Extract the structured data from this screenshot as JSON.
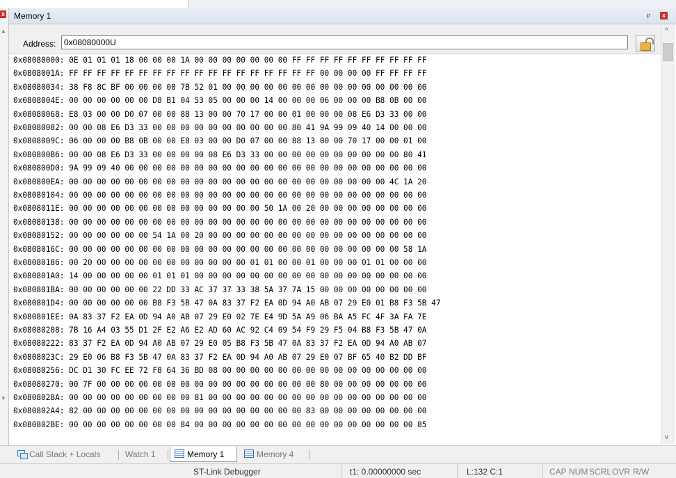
{
  "window": {
    "title": "Memory 1",
    "pin_glyph": "ᵽ",
    "close_glyph": "x"
  },
  "address_bar": {
    "label": "Address:",
    "value": "0x08080000U"
  },
  "memory_rows": [
    {
      "addr": "0x08080000:",
      "bytes": "0E 01 01 01 18 00 00 00 1A 00 00 00 00 00 00 00 FF FF FF FF FF FF FF FF FF FF"
    },
    {
      "addr": "0x0808001A:",
      "bytes": "FF FF FF FF FF FF FF FF FF FF FF FF FF FF FF FF FF FF 00 00 00 00 FF FF FF FF"
    },
    {
      "addr": "0x08080034:",
      "bytes": "38 F8 8C BF 00 00 00 00 7B 52 01 00 00 00 00 00 00 00 00 00 00 00 00 00 00 00"
    },
    {
      "addr": "0x0808004E:",
      "bytes": "00 00 00 00 00 00 D8 B1 04 53 05 00 00 00 14 00 00 00 06 00 00 00 B8 0B 00 00"
    },
    {
      "addr": "0x08080068:",
      "bytes": "E8 03 00 00 D0 07 00 00 88 13 00 00 70 17 00 00 01 00 00 00 08 E6 D3 33 00 00"
    },
    {
      "addr": "0x08080082:",
      "bytes": "00 00 08 E6 D3 33 00 00 00 00 00 00 00 00 00 00 80 41 9A 99 09 40 14 00 00 00"
    },
    {
      "addr": "0x0808009C:",
      "bytes": "06 00 00 00 B8 0B 00 00 E8 03 00 00 D0 07 00 00 88 13 00 00 70 17 00 00 01 00"
    },
    {
      "addr": "0x080800B6:",
      "bytes": "00 00 08 E6 D3 33 00 00 00 00 08 E6 D3 33 00 00 00 00 00 00 00 00 00 00 80 41"
    },
    {
      "addr": "0x080800D0:",
      "bytes": "9A 99 09 40 00 00 00 00 00 00 00 00 00 00 00 00 00 00 00 00 00 00 00 00 00 00"
    },
    {
      "addr": "0x080800EA:",
      "bytes": "00 00 00 00 00 00 00 00 00 00 00 00 00 00 00 00 00 00 00 00 00 00 00 4C 1A 20"
    },
    {
      "addr": "0x08080104:",
      "bytes": "00 00 00 00 00 00 00 00 00 00 00 00 00 00 00 00 00 00 00 00 00 00 00 00 00 00"
    },
    {
      "addr": "0x0808011E:",
      "bytes": "00 00 00 00 00 00 00 00 00 00 00 00 00 00 50 1A 00 20 00 00 00 00 00 00 00 00"
    },
    {
      "addr": "0x08080138:",
      "bytes": "00 00 00 00 00 00 00 00 00 00 00 00 00 00 00 00 00 00 00 00 00 00 00 00 00 00"
    },
    {
      "addr": "0x08080152:",
      "bytes": "00 00 00 00 00 00 54 1A 00 20 00 00 00 00 00 00 00 00 00 00 00 00 00 00 00 00"
    },
    {
      "addr": "0x0808016C:",
      "bytes": "00 00 00 00 00 00 00 00 00 00 00 00 00 00 00 00 00 00 00 00 00 00 00 00 58 1A"
    },
    {
      "addr": "0x08080186:",
      "bytes": "00 20 00 00 00 00 00 00 00 00 00 00 00 01 01 00 00 01 00 00 00 01 01 00 00 00"
    },
    {
      "addr": "0x080801A0:",
      "bytes": "14 00 00 00 00 00 01 01 01 00 00 00 00 00 00 00 00 00 00 00 00 00 00 00 00 00"
    },
    {
      "addr": "0x080801BA:",
      "bytes": "00 00 00 00 00 00 22 DD 33 AC 37 37 33 38 5A 37 7A 15 00 00 00 00 00 00 00 00"
    },
    {
      "addr": "0x080801D4:",
      "bytes": "00 00 00 00 00 00 B8 F3 5B 47 0A 83 37 F2 EA 0D 94 A0 AB 07 29 E0 01 B8 F3 5B 47"
    },
    {
      "addr": "0x080801EE:",
      "bytes": "0A 83 37 F2 EA 0D 94 A0 AB 07 29 E0 02 7E E4 9D 5A A9 06 BA A5 FC 4F 3A FA 7E"
    },
    {
      "addr": "0x08080208:",
      "bytes": "7B 16 A4 03 55 D1 2F E2 A6 E2 AD 60 AC 92 C4 09 54 F9 29 F5 04 B8 F3 5B 47 0A"
    },
    {
      "addr": "0x08080222:",
      "bytes": "83 37 F2 EA 0D 94 A0 AB 07 29 E0 05 B8 F3 5B 47 0A 83 37 F2 EA 0D 94 A0 AB 07"
    },
    {
      "addr": "0x0808023C:",
      "bytes": "29 E0 06 B8 F3 5B 47 0A 83 37 F2 EA 0D 94 A0 AB 07 29 E0 07 BF 65 40 B2 DD BF"
    },
    {
      "addr": "0x08080256:",
      "bytes": "DC D1 30 FC EE 72 F8 64 36 BD 08 00 00 00 00 00 00 00 00 00 00 00 00 00 00 00"
    },
    {
      "addr": "0x08080270:",
      "bytes": "00 7F 00 00 00 00 00 00 00 00 00 00 00 00 00 00 00 00 80 00 00 00 00 00 00 00"
    },
    {
      "addr": "0x0808028A:",
      "bytes": "00 00 00 00 00 00 00 00 00 81 00 00 00 00 00 00 00 00 00 00 00 00 00 00 00 00"
    },
    {
      "addr": "0x080802A4:",
      "bytes": "82 00 00 00 00 00 00 00 00 00 00 00 00 00 00 00 00 83 00 00 00 00 00 00 00 00"
    },
    {
      "addr": "0x080802BE:",
      "bytes": "00 00 00 00 00 00 00 00 84 00 00 00 00 00 00 00 00 00 00 00 00 00 00 00 00 85"
    }
  ],
  "tabs": [
    {
      "label": "Call Stack + Locals",
      "icon": "call-stack-icon",
      "active": false
    },
    {
      "label": "Watch 1",
      "icon": "",
      "active": false
    },
    {
      "label": "Memory 1",
      "icon": "memory-icon",
      "active": true
    },
    {
      "label": "Memory 4",
      "icon": "memory-icon",
      "active": false
    }
  ],
  "status": {
    "debugger": "ST-Link Debugger",
    "time": "t1: 0.00000000 sec",
    "position": "L:132 C:1",
    "indicators": [
      "CAP",
      "NUM",
      "SCRL",
      "OVR",
      "R/W"
    ]
  }
}
